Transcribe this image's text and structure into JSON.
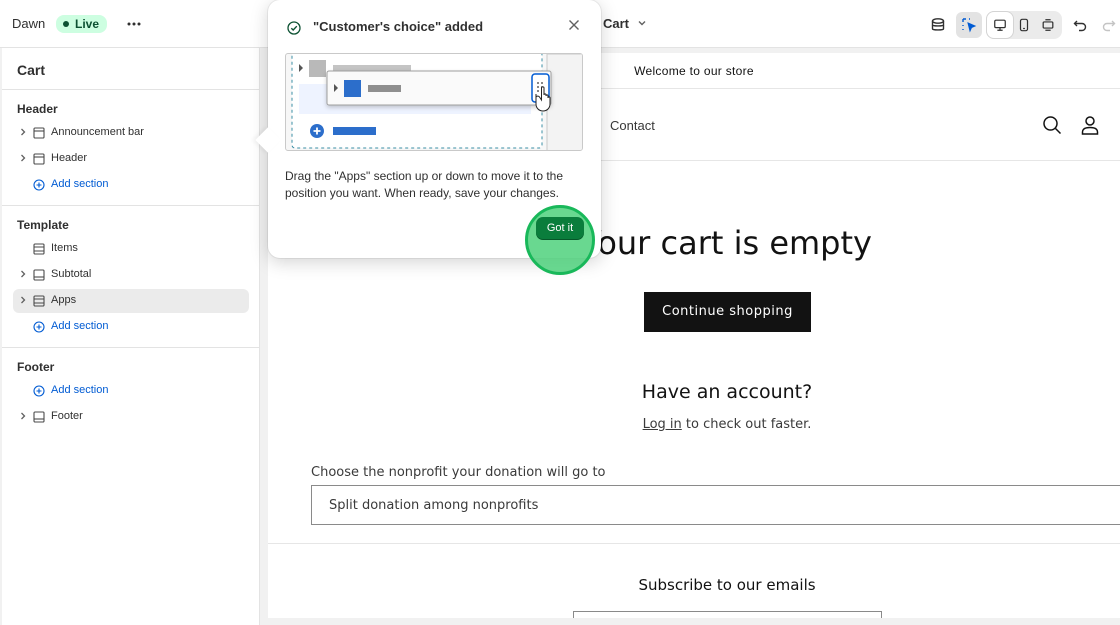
{
  "topbar": {
    "theme_name": "Dawn",
    "status_badge": "Live",
    "more_icon": "more-horizontal-icon",
    "page_selector": "Cart",
    "icons": [
      "database-icon",
      "inspector-select-icon",
      "desktop-icon",
      "mobile-icon",
      "fullscreen-icon",
      "undo-icon",
      "redo-icon"
    ],
    "accent": "#005bd3"
  },
  "sidebar": {
    "title": "Cart",
    "groups": [
      {
        "label": "Header",
        "items": [
          {
            "label": "Announcement bar",
            "icon": "section-icon",
            "expandable": true
          },
          {
            "label": "Header",
            "icon": "section-icon",
            "expandable": true
          },
          {
            "label": "Add section",
            "icon": "add-circle-icon",
            "add": true
          }
        ]
      },
      {
        "label": "Template",
        "items": [
          {
            "label": "Items",
            "icon": "section-icon",
            "expandable": false
          },
          {
            "label": "Subtotal",
            "icon": "section-icon",
            "expandable": true
          },
          {
            "label": "Apps",
            "icon": "section-icon",
            "expandable": true,
            "selected": true
          },
          {
            "label": "Add section",
            "icon": "add-circle-icon",
            "add": true
          }
        ]
      },
      {
        "label": "Footer",
        "items": [
          {
            "label": "Add section",
            "icon": "add-circle-icon",
            "add": true
          },
          {
            "label": "Footer",
            "icon": "section-icon",
            "expandable": true
          }
        ]
      }
    ]
  },
  "popover": {
    "title": "\"Customer's choice\" added",
    "description": "Drag the \"Apps\" section up or down to move it to the position you want. When ready, save your changes.",
    "button": "Got it",
    "check_icon": "check-circle-icon",
    "close_icon": "close-icon"
  },
  "preview": {
    "announcement": "Welcome to our store",
    "nav_contact": "Contact",
    "cart_empty": "Your cart is empty",
    "continue_shopping": "Continue shopping",
    "have_account": "Have an account?",
    "login_link": "Log in",
    "login_suffix": " to check out faster.",
    "donation_label": "Choose the nonprofit your donation will go to",
    "donation_value": "Split donation among nonprofits",
    "subscribe": "Subscribe to our emails"
  }
}
